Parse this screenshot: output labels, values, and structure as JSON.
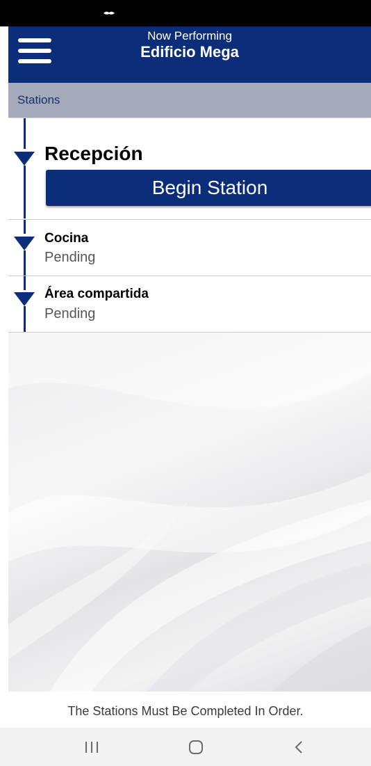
{
  "status_bar": {
    "icon": "hands-icon"
  },
  "header": {
    "menu_icon": "hamburger-menu-icon",
    "subtitle": "Now Performing",
    "title": "Edificio Mega",
    "background_color": "#0b2d7a"
  },
  "stations_bar": {
    "label": "Stations",
    "background_color": "#a5aaba"
  },
  "stations": [
    {
      "name": "Recepción",
      "action_label": "Begin Station"
    },
    {
      "name": "Cocina",
      "status": "Pending"
    },
    {
      "name": "Área compartida",
      "status": "Pending"
    }
  ],
  "footer": {
    "text": "The Stations Must Be Completed In Order."
  },
  "nav_bar": {
    "recents_icon": "recents-icon",
    "home_icon": "home-icon",
    "back_icon": "back-icon"
  }
}
